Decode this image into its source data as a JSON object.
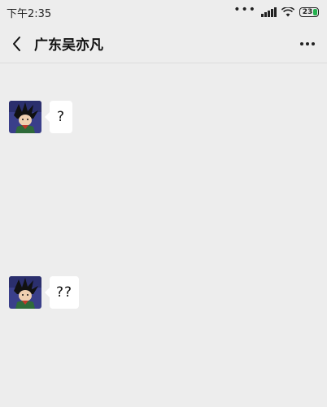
{
  "status_bar": {
    "time": "下午2:35",
    "battery": "23"
  },
  "nav": {
    "title": "广东吴亦凡"
  },
  "messages": [
    {
      "text": "?"
    },
    {
      "text": "??"
    }
  ],
  "colors": {
    "background": "#ededed",
    "bubble": "#ffffff",
    "battery_accent": "#23b14d"
  },
  "icons": {
    "back": "chevron-left-icon",
    "more": "more-dots-icon",
    "signal": "signal-icon",
    "wifi": "wifi-icon",
    "battery": "battery-icon"
  }
}
